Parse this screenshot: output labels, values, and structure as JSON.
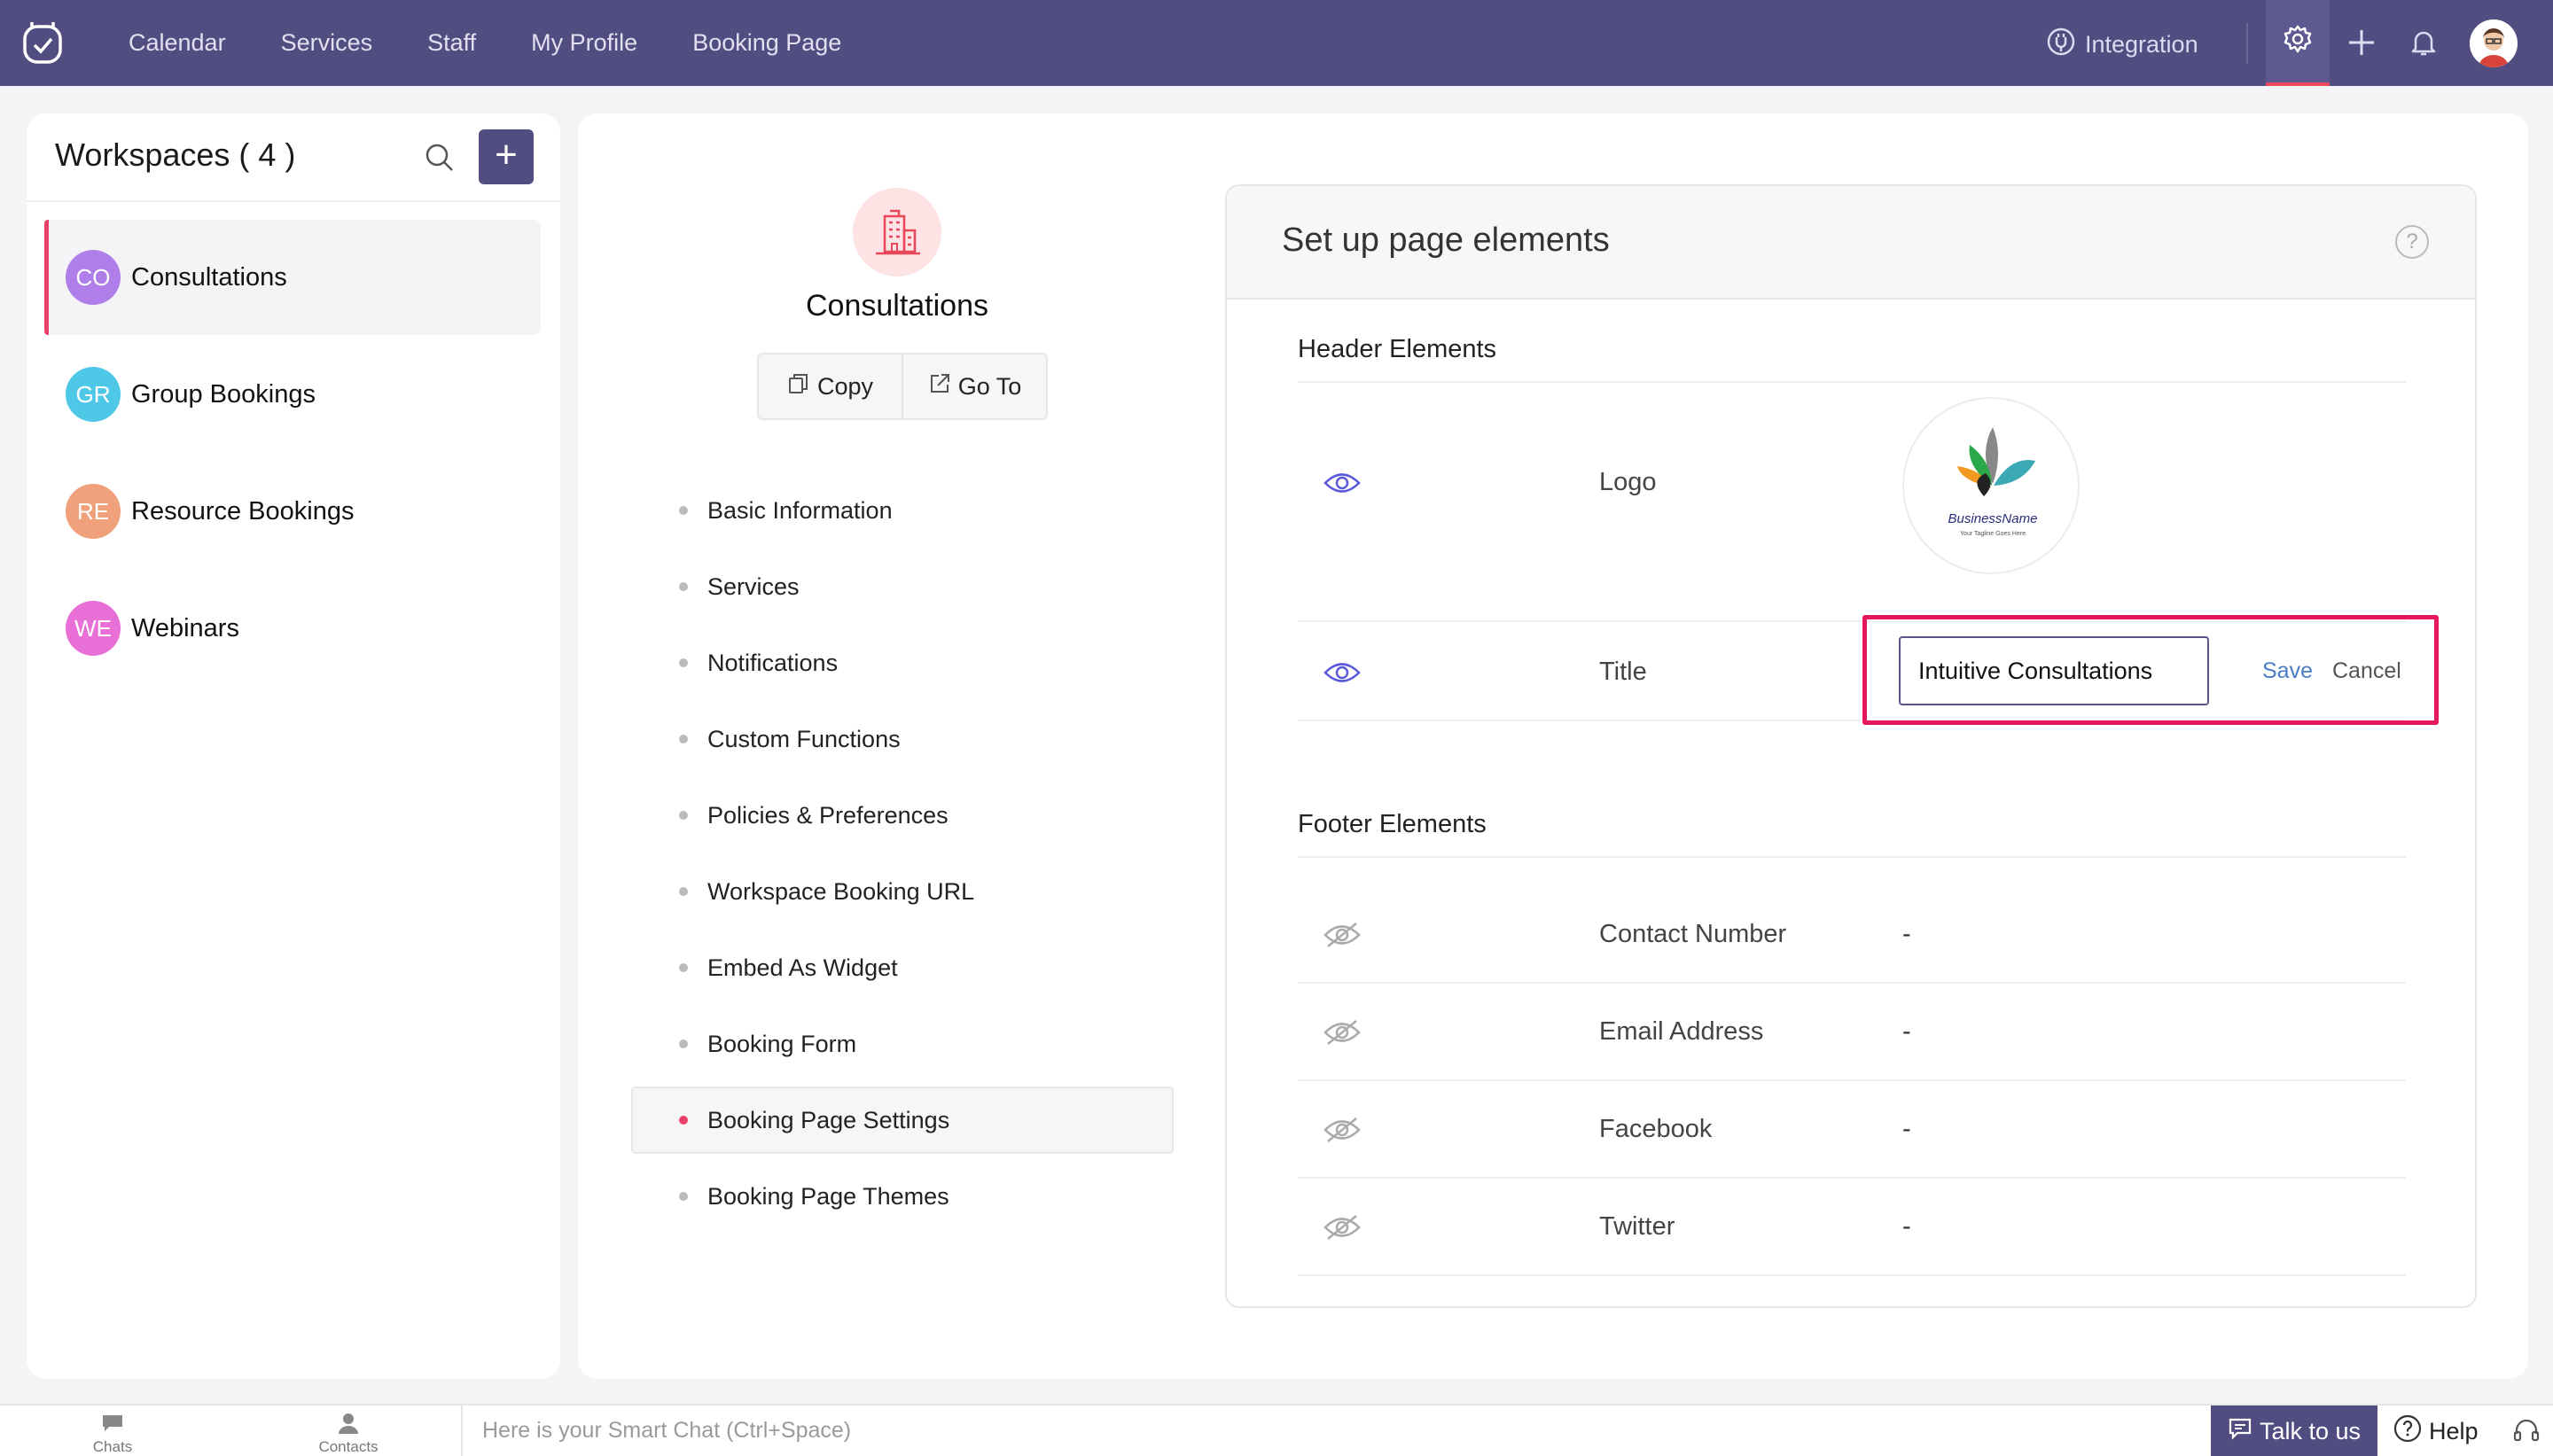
{
  "topbar": {
    "nav": [
      "Calendar",
      "Services",
      "Staff",
      "My Profile",
      "Booking Page"
    ],
    "integration_label": "Integration",
    "icons": [
      "app-logo-icon",
      "integration-icon",
      "gear-icon",
      "plus-icon",
      "bell-icon",
      "user-avatar"
    ],
    "accent_color": "#524d81",
    "active_indicator_color": "#e8485a"
  },
  "sidebar": {
    "title": "Workspaces ( 4 )",
    "items": [
      {
        "initials": "CO",
        "name": "Consultations",
        "color": "#b07ee8",
        "active": true
      },
      {
        "initials": "GR",
        "name": "Group Bookings",
        "color": "#4fc8e8",
        "active": false
      },
      {
        "initials": "RE",
        "name": "Resource Bookings",
        "color": "#f0a07a",
        "active": false
      },
      {
        "initials": "WE",
        "name": "Webinars",
        "color": "#e86fd6",
        "active": false
      }
    ]
  },
  "workspace": {
    "name": "Consultations",
    "copy_label": "Copy",
    "goto_label": "Go To",
    "menu": [
      "Basic Information",
      "Services",
      "Notifications",
      "Custom Functions",
      "Policies & Preferences",
      "Workspace Booking URL",
      "Embed As Widget",
      "Booking Form",
      "Booking Page Settings",
      "Booking Page Themes"
    ],
    "active_menu": "Booking Page Settings"
  },
  "panel": {
    "title": "Set up page elements",
    "header_section": "Header Elements",
    "header_rows": [
      {
        "label": "Logo",
        "visible": true
      },
      {
        "label": "Title",
        "visible": true
      }
    ],
    "logo_text": "BusinessName",
    "logo_tagline": "Your Tagline Goes Here",
    "title_input_value": "Intuitive Consultations",
    "save_label": "Save",
    "cancel_label": "Cancel",
    "footer_section": "Footer Elements",
    "footer_rows": [
      {
        "label": "Contact Number",
        "value": "-",
        "visible": false
      },
      {
        "label": "Email Address",
        "value": "-",
        "visible": false
      },
      {
        "label": "Facebook",
        "value": "-",
        "visible": false
      },
      {
        "label": "Twitter",
        "value": "-",
        "visible": false
      }
    ],
    "highlight_color": "#e5185c"
  },
  "bottombar": {
    "chats_label": "Chats",
    "contacts_label": "Contacts",
    "smartchat_placeholder": "Here is your Smart Chat (Ctrl+Space)",
    "talk_label": "Talk to us",
    "help_label": "Help"
  }
}
